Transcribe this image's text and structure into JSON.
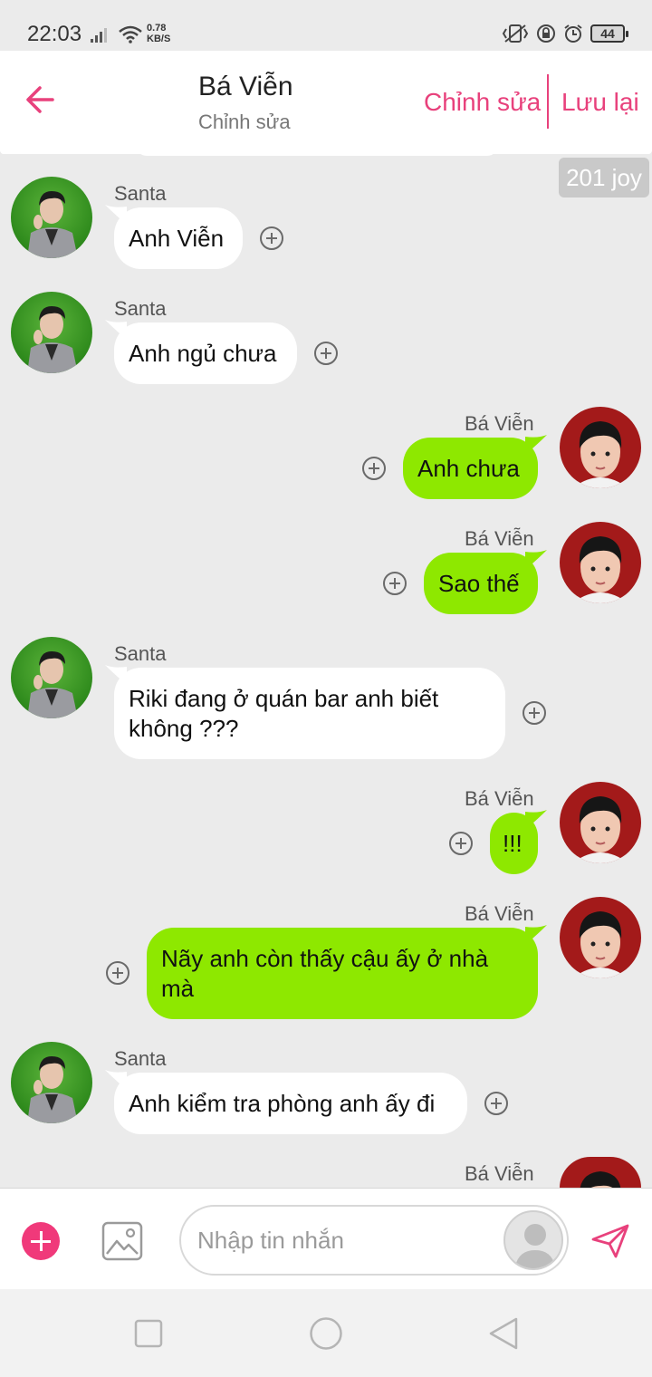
{
  "status_bar": {
    "time": "22:03",
    "net_speed_value": "0.78",
    "net_speed_unit": "KB/S",
    "battery": "44"
  },
  "header": {
    "back_icon": "arrow-left-icon",
    "title": "Bá Viễn",
    "subtitle": "Chỉnh sửa",
    "edit_label": "Chỉnh sửa",
    "save_label": "Lưu lại",
    "accent_color": "#e8417c"
  },
  "joy_badge": "201 joy",
  "messages": [
    {
      "sender": "Santa",
      "text_lines": [
        "Anh Viễn"
      ],
      "side": "in"
    },
    {
      "sender": "Santa",
      "text_lines": [
        "Anh ngủ chưa"
      ],
      "side": "in"
    },
    {
      "sender": "Bá Viễn",
      "text_lines": [
        "Anh chưa"
      ],
      "side": "out"
    },
    {
      "sender": "Bá Viễn",
      "text_lines": [
        "Sao thế"
      ],
      "side": "out"
    },
    {
      "sender": "Santa",
      "text_lines": [
        "Riki đang ở quán bar anh biết",
        "không ???"
      ],
      "side": "in"
    },
    {
      "sender": "Bá Viễn",
      "text_lines": [
        "!!!"
      ],
      "side": "out"
    },
    {
      "sender": "Bá Viễn",
      "text_lines": [
        "Nãy anh còn thấy cậu ấy ở nhà",
        "mà"
      ],
      "side": "out"
    },
    {
      "sender": "Santa",
      "text_lines": [
        "Anh kiểm tra phòng anh ấy đi"
      ],
      "side": "in"
    },
    {
      "sender": "Bá Viễn",
      "text_lines": [],
      "side": "out"
    }
  ],
  "input_bar": {
    "placeholder": "Nhập tin nhắn",
    "add_icon": "plus-icon",
    "image_icon": "image-icon",
    "send_icon": "send-icon"
  },
  "colors": {
    "incoming_bubble": "#ffffff",
    "outgoing_bubble": "#8ee800",
    "background": "#ebebeb"
  }
}
